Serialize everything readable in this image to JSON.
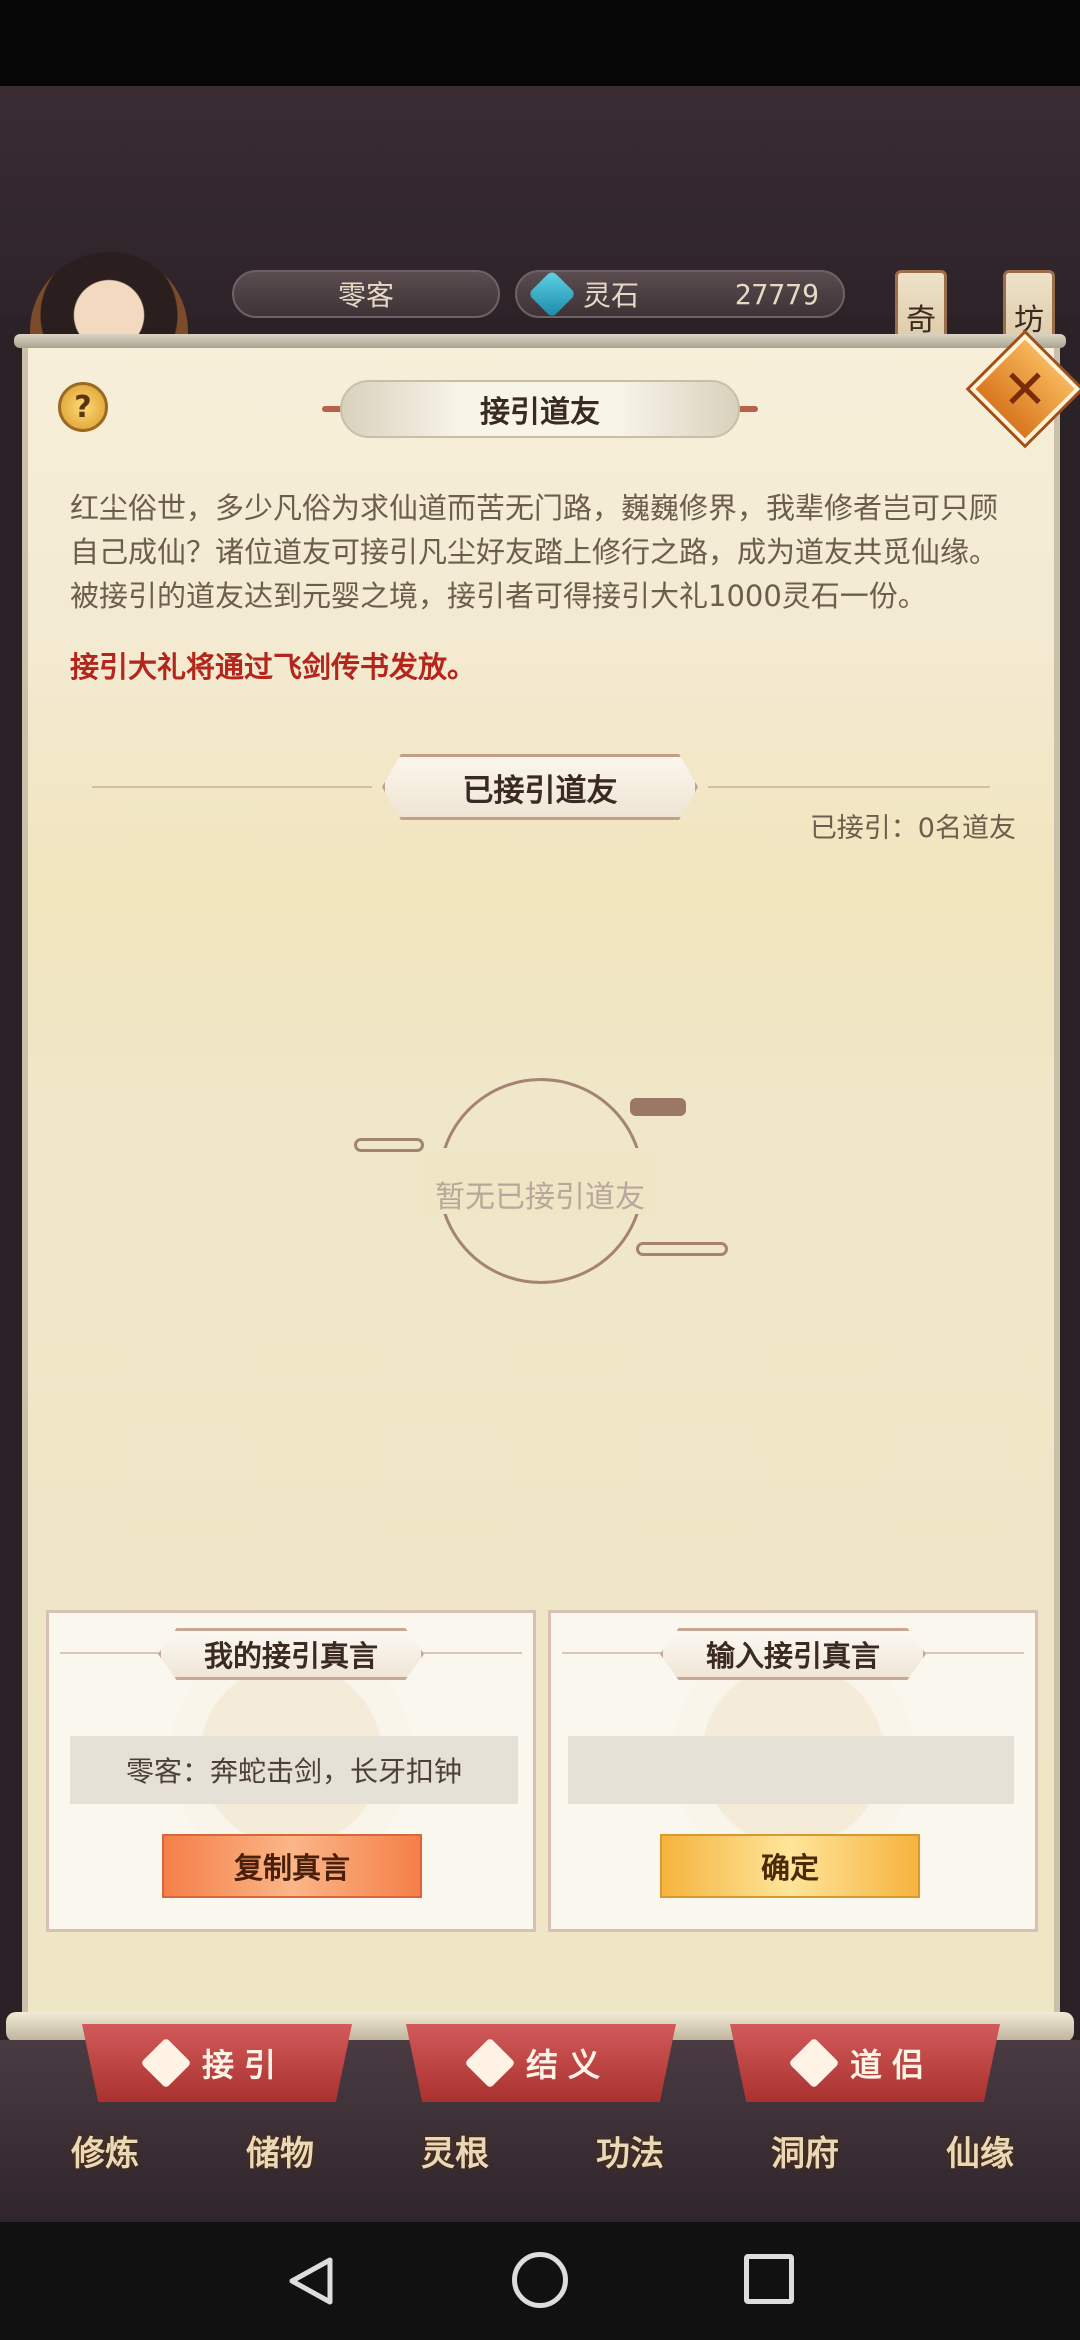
{
  "header": {
    "player_name": "零客",
    "currency_label": "灵石",
    "currency_value": "27779",
    "side_qi": "奇",
    "side_fang": "坊"
  },
  "dialog": {
    "title": "接引道友",
    "intro": "红尘俗世，多少凡俗为求仙道而苦无门路，巍巍修界，我辈修者岂可只顾自己成仙？诸位道友可接引凡尘好友踏上修行之路，成为道友共觅仙缘。被接引的道友达到元婴之境，接引者可得接引大礼1000灵石一份。",
    "notice": "接引大礼将通过飞剑传书发放。",
    "section_title": "已接引道友",
    "count_text": "已接引：0名道友",
    "empty_text": "暂无已接引道友",
    "help_glyph": "?",
    "close_glyph": "✕"
  },
  "my_code": {
    "title": "我的接引真言",
    "value": "零客：奔蛇击剑，长牙扣钟",
    "button": "复制真言"
  },
  "input_code": {
    "title": "输入接引真言",
    "value": "",
    "placeholder": "",
    "button": "确定"
  },
  "tabs": [
    {
      "label": "接引"
    },
    {
      "label": "结义"
    },
    {
      "label": "道侣"
    }
  ],
  "bottom_nav": [
    {
      "label": "修炼"
    },
    {
      "label": "储物"
    },
    {
      "label": "灵根"
    },
    {
      "label": "功法"
    },
    {
      "label": "洞府"
    },
    {
      "label": "仙缘"
    }
  ],
  "colors": {
    "notice": "#b4261c",
    "copy_button": "#f57f49",
    "confirm_button": "#f6b33e",
    "tab_ribbon": "#c04646"
  }
}
